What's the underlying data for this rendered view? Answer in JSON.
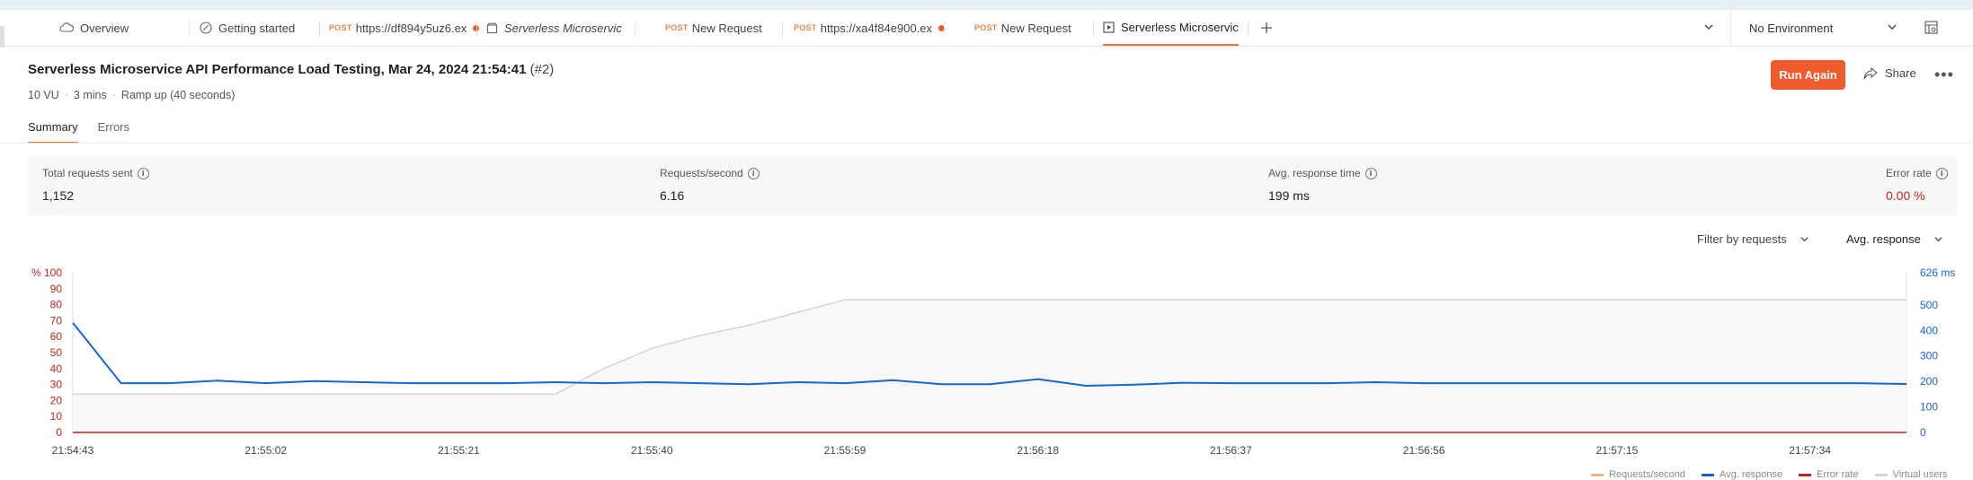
{
  "tabs": [
    {
      "method": "",
      "label": "Overview",
      "icon": "cloud-icon",
      "italic": false,
      "dot": false
    },
    {
      "method": "",
      "label": "Getting started",
      "icon": "rocket-icon",
      "italic": false,
      "dot": false
    },
    {
      "method": "POST",
      "label": "https://df894y5uz6.ex",
      "icon": "",
      "italic": false,
      "dot": true
    },
    {
      "method": "",
      "label": "Serverless Microservice A",
      "icon": "collection-icon",
      "italic": true,
      "dot": false
    },
    {
      "method": "POST",
      "label": "New Request",
      "icon": "",
      "italic": false,
      "dot": false
    },
    {
      "method": "POST",
      "label": "https://xa4f84e900.ex",
      "icon": "",
      "italic": false,
      "dot": true
    },
    {
      "method": "POST",
      "label": "New Request",
      "icon": "",
      "italic": false,
      "dot": false
    },
    {
      "method": "",
      "label": "Serverless Microservice A",
      "icon": "runner-icon",
      "italic": false,
      "dot": false
    }
  ],
  "environment": "No Environment",
  "run": {
    "title": "Serverless Microservice API Performance Load Testing, Mar 24, 2024 21:54:41",
    "run_id": "(#2)",
    "vu": "10 VU",
    "duration": "3 mins",
    "ramp": "Ramp up (40 seconds)",
    "run_again": "Run Again",
    "share": "Share"
  },
  "subtabs": [
    "Summary",
    "Errors"
  ],
  "stats": {
    "total_label": "Total requests sent",
    "total_value": "1,152",
    "rps_label": "Requests/second",
    "rps_value": "6.16",
    "avg_label": "Avg. response time",
    "avg_value": "199 ms",
    "err_label": "Error rate",
    "err_value": "0.00 %"
  },
  "filters": {
    "filter_label": "Filter by requests",
    "metric_label": "Avg. response"
  },
  "colors": {
    "accent": "#ff6c37",
    "error": "#c4261d",
    "response": "#1565d8",
    "virtual_users": "#d6d6d6",
    "rps": "#f4b183"
  },
  "chart_data": {
    "type": "line",
    "x": [
      "21:54:43",
      "21:54:48",
      "21:54:53",
      "21:54:58",
      "21:55:02",
      "21:55:07",
      "21:55:12",
      "21:55:16",
      "21:55:21",
      "21:55:26",
      "21:55:30",
      "21:55:35",
      "21:55:40",
      "21:55:45",
      "21:55:49",
      "21:55:54",
      "21:55:59",
      "21:56:04",
      "21:56:08",
      "21:56:13",
      "21:56:18",
      "21:56:23",
      "21:56:27",
      "21:56:32",
      "21:56:37",
      "21:56:42",
      "21:56:46",
      "21:56:51",
      "21:56:56",
      "21:57:01",
      "21:57:05",
      "21:57:10",
      "21:57:15",
      "21:57:20",
      "21:57:24",
      "21:57:29",
      "21:57:34",
      "21:57:39",
      "21:57:43"
    ],
    "x_tick_labels": [
      "21:54:43",
      "21:55:02",
      "21:55:21",
      "21:55:40",
      "21:55:59",
      "21:56:18",
      "21:56:37",
      "21:56:56",
      "21:57:15",
      "21:57:34"
    ],
    "left_axis": {
      "label": "%",
      "ticks": [
        100,
        90,
        80,
        70,
        60,
        50,
        40,
        30,
        20,
        10,
        0
      ],
      "range": [
        0,
        100
      ]
    },
    "right_axis": {
      "ticks": [
        0,
        100,
        200,
        300,
        400,
        500
      ],
      "max_label": "626 ms",
      "range": [
        0,
        626
      ]
    },
    "series": [
      {
        "name": "Avg. response",
        "axis": "right",
        "color": "#1565d8",
        "values": [
          430,
          193,
          193,
          203,
          193,
          201,
          197,
          193,
          193,
          193,
          197,
          193,
          197,
          193,
          189,
          197,
          193,
          205,
          189,
          189,
          209,
          183,
          187,
          195,
          193,
          193,
          193,
          197,
          193,
          193,
          193,
          193,
          193,
          193,
          193,
          193,
          193,
          193,
          190
        ]
      },
      {
        "name": "Virtual users",
        "axis": "right",
        "color": "#d6d6d6",
        "values": [
          150,
          150,
          150,
          150,
          150,
          150,
          150,
          150,
          150,
          150,
          150,
          250,
          330,
          380,
          420,
          470,
          520,
          520,
          520,
          520,
          520,
          520,
          520,
          520,
          520,
          520,
          520,
          520,
          520,
          520,
          520,
          520,
          520,
          520,
          520,
          520,
          520,
          520,
          520
        ]
      },
      {
        "name": "Error rate",
        "axis": "left",
        "color": "#c4261d",
        "values": [
          0,
          0,
          0,
          0,
          0,
          0,
          0,
          0,
          0,
          0,
          0,
          0,
          0,
          0,
          0,
          0,
          0,
          0,
          0,
          0,
          0,
          0,
          0,
          0,
          0,
          0,
          0,
          0,
          0,
          0,
          0,
          0,
          0,
          0,
          0,
          0,
          0,
          0,
          0
        ]
      }
    ],
    "legend": [
      "Requests/second",
      "Avg. response",
      "Error rate",
      "Virtual users"
    ],
    "legend_position": "bottom-right"
  }
}
